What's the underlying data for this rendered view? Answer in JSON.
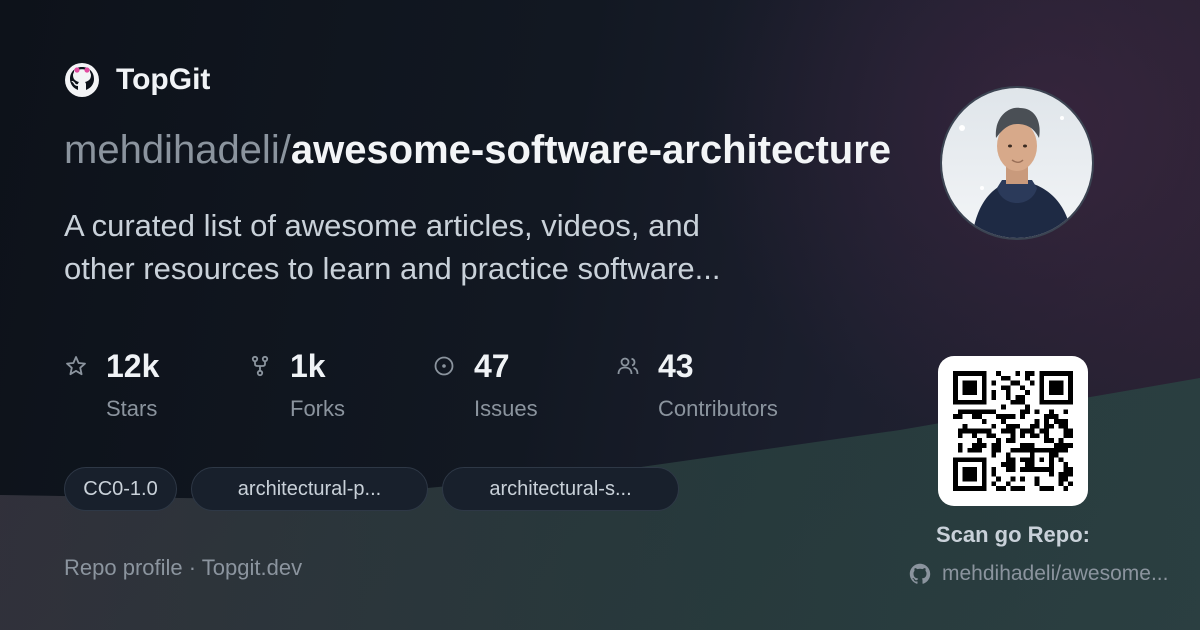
{
  "brand": {
    "name": "TopGit",
    "logo_icon": "github-octocat-icon"
  },
  "repo": {
    "owner": "mehdihadeli",
    "separator": "/",
    "name": "awesome-software-architecture",
    "description": "A curated list of awesome articles, videos, and other resources to learn and practice software..."
  },
  "avatar": {
    "icon": "user-avatar-photo"
  },
  "stats": [
    {
      "icon": "star-icon",
      "value": "12k",
      "label": "Stars"
    },
    {
      "icon": "fork-icon",
      "value": "1k",
      "label": "Forks"
    },
    {
      "icon": "issue-icon",
      "value": "47",
      "label": "Issues"
    },
    {
      "icon": "people-icon",
      "value": "43",
      "label": "Contributors"
    }
  ],
  "tags": [
    "CC0-1.0",
    "architectural-p...",
    "architectural-s..."
  ],
  "footer": {
    "text": "Repo profile · Topgit.dev"
  },
  "qr": {
    "caption": "Scan go Repo:",
    "repo_link": "mehdihadeli/awesome...",
    "link_icon": "github-icon"
  },
  "colors": {
    "background": "#0f141c",
    "text": "#e6edf3",
    "muted": "#8b949e",
    "tag_bg": "#18202c"
  }
}
